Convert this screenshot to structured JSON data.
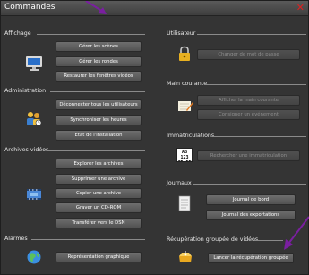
{
  "window": {
    "title": "Commandes",
    "close_glyph": "✕"
  },
  "colors": {
    "accent_arrow": "#7a1fa0",
    "close": "#e02020",
    "background": "#343434"
  },
  "sections": {
    "affichage": {
      "label": "Affichage",
      "buttons": [
        "Gérer les scènes",
        "Gérer les rondes",
        "Restaurer les fenêtres vidéos"
      ]
    },
    "administration": {
      "label": "Administration",
      "buttons": [
        "Déconnecter tous les utilisateurs",
        "Synchroniser les heures",
        "Etat de l'installation"
      ]
    },
    "archives": {
      "label": "Archives vidéos",
      "buttons": [
        "Explorer les archives",
        "Supprimer une archive",
        "Copier une archive",
        "Graver un CD-ROM",
        "Transférer vers le DSN"
      ]
    },
    "alarmes": {
      "label": "Alarmes",
      "buttons": [
        "Représentation graphique"
      ]
    },
    "utilisateur": {
      "label": "Utilisateur",
      "buttons": [
        "Changer de mot de passe"
      ]
    },
    "main_courante": {
      "label": "Main courante",
      "buttons": [
        "Afficher la main courante",
        "Consigner un événement"
      ]
    },
    "immatriculations": {
      "label": "Immatriculations",
      "buttons": [
        "Rechercher une immatriculation"
      ],
      "icon_text": "AB 123 CD-EF"
    },
    "journaux": {
      "label": "Journaux",
      "buttons": [
        "Journal de bord",
        "Journal des exportations"
      ]
    },
    "recuperation": {
      "label": "Récupération groupée de vidéos",
      "buttons": [
        "Lancer la récupération groupée"
      ]
    }
  },
  "icons": [
    "monitor-icon",
    "users-clock-icon",
    "archive-film-icon",
    "globe-icon",
    "padlock-icon",
    "notepad-pencil-icon",
    "license-plate-icon",
    "journal-document-icon",
    "drawer-download-icon",
    "pointer-arrow-icon"
  ]
}
